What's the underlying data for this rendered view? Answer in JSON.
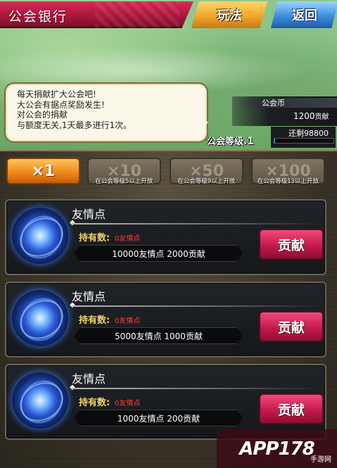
{
  "header": {
    "title": "公会银行",
    "rules_label": "玩法",
    "back_label": "返回"
  },
  "bubble": {
    "lines": [
      "每天捐献扩大公会吧!",
      "大公会有据点奖励发生!",
      "对公会的捐献",
      "与额度无关,1天最多进行1次。"
    ]
  },
  "guild": {
    "coin_label": "公会币",
    "coin_value": "1200",
    "coin_unit": "贡献",
    "level_label": "公会等级.",
    "level_value": "1",
    "remaining_label": "还剩98800",
    "remaining_fraction": 0.012
  },
  "multipliers": [
    {
      "label": "×1",
      "note": ""
    },
    {
      "label": "×10",
      "note": "在公会等级5以上开放"
    },
    {
      "label": "×50",
      "note": "在公会等级9以上开放"
    },
    {
      "label": "×100",
      "note": "在公会等级13以上开放"
    }
  ],
  "cards": [
    {
      "title": "友情点",
      "holding_label": "持有数:",
      "holding_value": "0友情点",
      "cost": "10000友情点  2000贡献",
      "button": "贡献"
    },
    {
      "title": "友情点",
      "holding_label": "持有数:",
      "holding_value": "0友情点",
      "cost": "5000友情点  1000贡献",
      "button": "贡献"
    },
    {
      "title": "友情点",
      "holding_label": "持有数:",
      "holding_value": "0友情点",
      "cost": "1000友情点  200贡献",
      "button": "贡献"
    }
  ],
  "watermark": {
    "text": "APP178",
    "sub": "手游网"
  },
  "colors": {
    "title_bar": "#a7163d",
    "rules_button": "#f0a728",
    "back_button": "#3d8fe0",
    "contribute_button": "#c41a4a",
    "holding_value": "#ff3a3a",
    "holding_label": "#f2d36a"
  }
}
